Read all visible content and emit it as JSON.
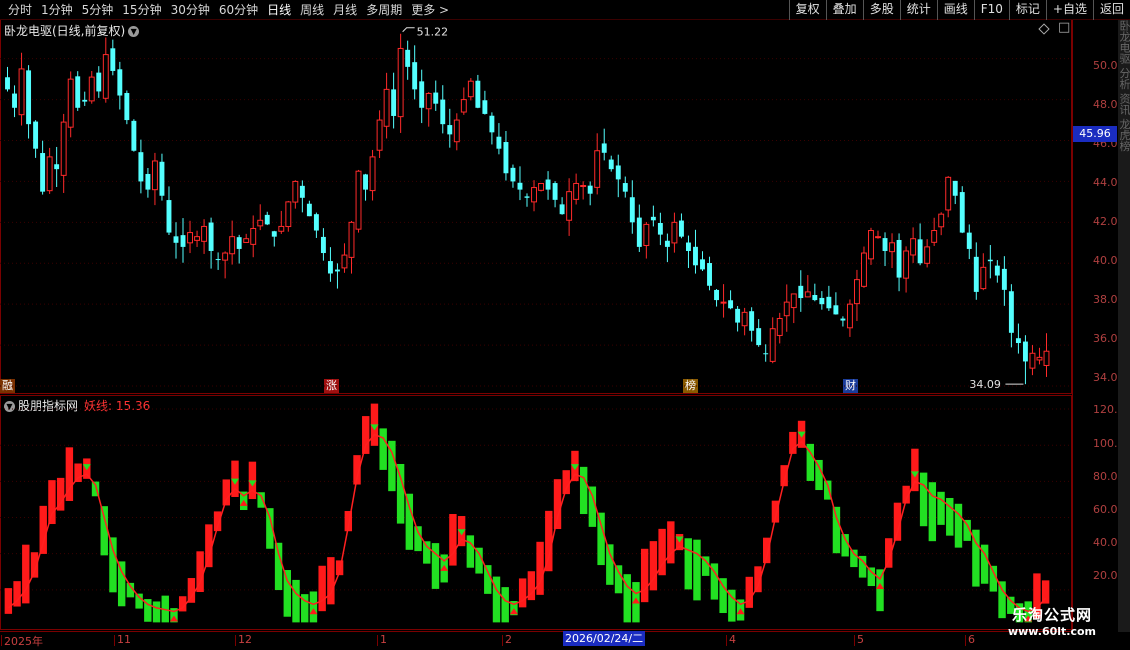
{
  "toolbar": {
    "periods": [
      "分时",
      "1分钟",
      "5分钟",
      "15分钟",
      "30分钟",
      "60分钟",
      "日线",
      "周线",
      "月线",
      "多周期",
      "更多 >"
    ],
    "tools": [
      "复权",
      "叠加",
      "多股",
      "统计",
      "画线",
      "F10",
      "标记",
      "+自选",
      "返回"
    ]
  },
  "main": {
    "title": "卧龙电驱(日线,前复权)",
    "price_labels": [
      "50.00",
      "48.00",
      "46.00",
      "44.00",
      "42.00",
      "40.00",
      "38.00",
      "36.00",
      "34.00"
    ],
    "current_price": "45.96",
    "high_label": "51.22",
    "low_label": "34.09",
    "events": [
      "融",
      "涨",
      "榜",
      "财"
    ]
  },
  "sub": {
    "name": "股朋指标网",
    "indicator_label": "妖线: 15.36",
    "value_labels": [
      "120.0",
      "100.0",
      "80.00",
      "60.00",
      "40.00",
      "20.00"
    ]
  },
  "dates": {
    "labels": [
      "2025年",
      "11",
      "12",
      "1",
      "2",
      "4",
      "5",
      "6"
    ],
    "cursor": "2026/02/24/二"
  },
  "right_strip_text": "卧龙电驱 分析 资讯 龙虎榜",
  "watermark": {
    "line1": "乐淘公式网",
    "line2": "www.60lt.com"
  },
  "colors": {
    "up": "#ff2a2a",
    "down": "#54ffff",
    "bull": "#ff1a1a",
    "bear": "#22e022",
    "line": "#ff2020"
  },
  "chart_data": [
    {
      "type": "candlestick",
      "title": "卧龙电驱(日线,前复权)",
      "ylim": [
        34,
        51.5
      ],
      "y_ticks": [
        34,
        36,
        38,
        40,
        42,
        44,
        46,
        48,
        50
      ],
      "x_labels": [
        "2025年",
        "11",
        "12",
        "1",
        "2",
        "4",
        "5",
        "6"
      ],
      "close": [
        48.5,
        47.6,
        49.5,
        46.8,
        45.6,
        43.5,
        45.2,
        44.6,
        46.9,
        49.0,
        47.6,
        47.9,
        49.1,
        48.4,
        50.2,
        49.4,
        48.2,
        47.0,
        45.5,
        44.0,
        43.6,
        45.0,
        43.3,
        41.5,
        41.0,
        40.8,
        41.5,
        41.3,
        41.8,
        40.6,
        40.2,
        40.5,
        41.3,
        40.7,
        41.2,
        41.7,
        42.1,
        41.9,
        41.3,
        41.8,
        43.0,
        44.0,
        43.2,
        42.3,
        41.6,
        40.5,
        39.5,
        39.6,
        40.4,
        42.0,
        44.5,
        43.6,
        45.2,
        47.0,
        48.5,
        47.2,
        50.5,
        49.6,
        48.5,
        47.6,
        48.3,
        47.8,
        46.8,
        46.3,
        47.0,
        48.0,
        48.9,
        47.6,
        47.3,
        46.4,
        45.6,
        44.4,
        44.0,
        43.6,
        43.2,
        43.7,
        43.9,
        43.6,
        43.1,
        42.4,
        43.5,
        43.9,
        43.8,
        43.4,
        45.5,
        45.4,
        44.6,
        44.1,
        43.5,
        42.0,
        40.8,
        41.9,
        42.1,
        41.4,
        40.8,
        42.0,
        41.3,
        40.6,
        39.9,
        39.7,
        38.9,
        38.2,
        38.1,
        37.8,
        37.1,
        37.6,
        36.7,
        36.0,
        35.6,
        36.8,
        37.3,
        38.1,
        38.5,
        38.3,
        38.6,
        38.2,
        38.0,
        37.8,
        37.5,
        37.2,
        38.0,
        39.2,
        40.5,
        41.6,
        41.3,
        40.6,
        41.0,
        39.3,
        40.6,
        41.2,
        40.0,
        40.8,
        41.6,
        42.4,
        44.2,
        43.3,
        41.5,
        40.7,
        38.6,
        39.8,
        40.1,
        39.4,
        38.7,
        36.6,
        36.1,
        35.2,
        35.6,
        35.4,
        35.7
      ],
      "high": 51.22,
      "low": 34.09,
      "last_price": 45.96
    },
    {
      "type": "bar",
      "title": "股朋指标网",
      "series": [
        {
          "name": "妖线",
          "last_value": 15.36
        }
      ],
      "ylim": [
        0,
        125
      ],
      "y_ticks": [
        20,
        40,
        60,
        80,
        100,
        120
      ],
      "yao": [
        10,
        14,
        20,
        30,
        46,
        62,
        68,
        76,
        82,
        84,
        78,
        60,
        42,
        30,
        22,
        16,
        12,
        10,
        9,
        8,
        10,
        16,
        24,
        38,
        55,
        70,
        76,
        72,
        75,
        72,
        60,
        40,
        25,
        18,
        14,
        12,
        14,
        18,
        30,
        55,
        82,
        100,
        106,
        104,
        96,
        82,
        66,
        52,
        44,
        40,
        36,
        40,
        48,
        46,
        40,
        30,
        20,
        14,
        12,
        14,
        18,
        24,
        38,
        60,
        76,
        84,
        82,
        72,
        56,
        40,
        30,
        22,
        18,
        20,
        26,
        34,
        40,
        44,
        42,
        40,
        36,
        30,
        22,
        16,
        12,
        14,
        22,
        38,
        60,
        80,
        98,
        102,
        96,
        88,
        78,
        60,
        48,
        40,
        36,
        30,
        26,
        36,
        52,
        70,
        80,
        78,
        72,
        70,
        66,
        62,
        56,
        46,
        40,
        30,
        20,
        14,
        10,
        8,
        10,
        15.36
      ]
    }
  ]
}
